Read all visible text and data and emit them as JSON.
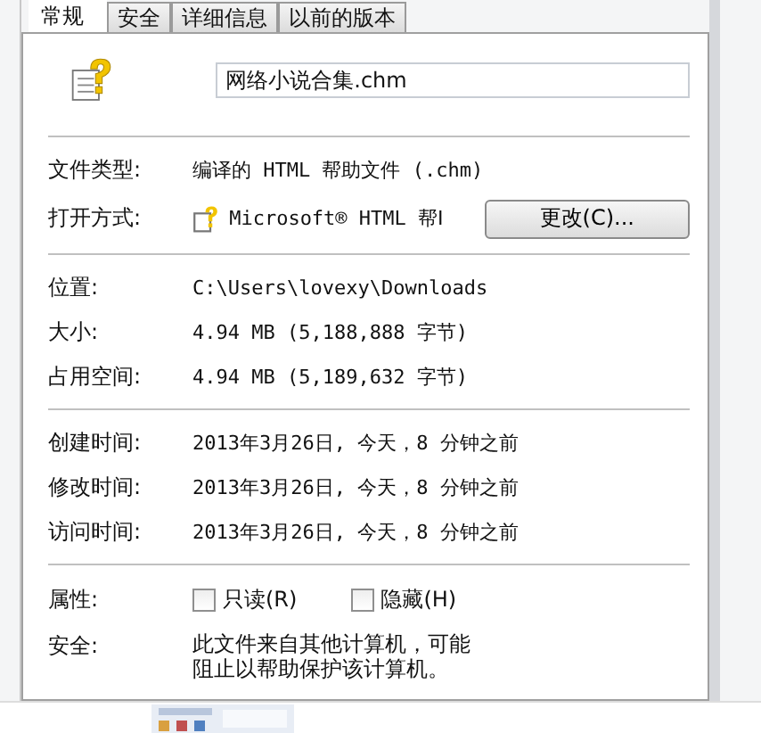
{
  "tabs": [
    {
      "label": "常规",
      "selected": true
    },
    {
      "label": "安全",
      "selected": false
    },
    {
      "label": "详细信息",
      "selected": false
    },
    {
      "label": "以前的版本",
      "selected": false
    }
  ],
  "file_name": {
    "value": "网络小说合集.chm"
  },
  "type_rows": [
    {
      "label": "文件类型:",
      "value": "编译的 HTML 帮助文件 (.chm)"
    }
  ],
  "open_with": {
    "label": "打开方式:",
    "value": "Microsoft® HTML 帮Ⅰ",
    "button": "更改(C)..."
  },
  "location_rows": [
    {
      "label": "位置:",
      "value": "C:\\Users\\lovexy\\Downloads"
    },
    {
      "label": "大小:",
      "value": "4.94 MB (5,188,888 字节)"
    },
    {
      "label": "占用空间:",
      "value": "4.94 MB (5,189,632 字节)"
    }
  ],
  "time_rows": [
    {
      "label": "创建时间:",
      "value": "2013年3月26日, 今天，8 分钟之前"
    },
    {
      "label": "修改时间:",
      "value": "2013年3月26日, 今天，8 分钟之前"
    },
    {
      "label": "访问时间:",
      "value": "2013年3月26日, 今天，8 分钟之前"
    }
  ],
  "attributes": {
    "label": "属性:",
    "options": [
      {
        "label": "只读(R)",
        "checked": false
      },
      {
        "label": "隐藏(H)",
        "checked": false
      }
    ]
  },
  "security": {
    "label": "安全:",
    "lines": [
      "此文件来自其他计算机，可能",
      "阻止以帮助保护该计算机。"
    ]
  }
}
